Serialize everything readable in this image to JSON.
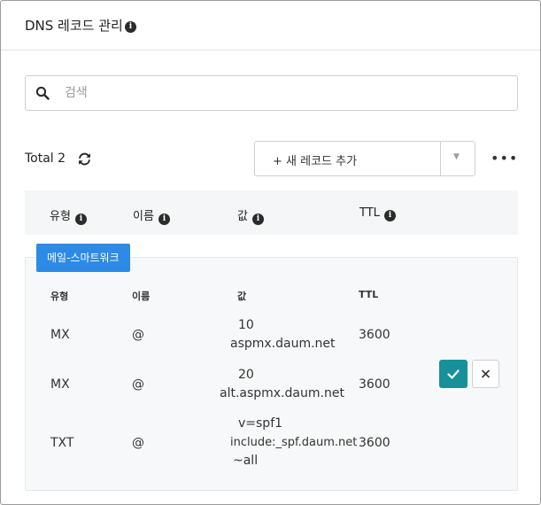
{
  "header": {
    "title": "DNS 레코드 관리"
  },
  "search": {
    "placeholder": "검색",
    "value": ""
  },
  "toolbar": {
    "total_label": "Total 2",
    "add_label": "+ 새 레코드 추가"
  },
  "table": {
    "columns": [
      "유형",
      "이름",
      "값",
      "TTL"
    ]
  },
  "group": {
    "tag": "메일-스마트워크",
    "columns": [
      "유형",
      "이름",
      "값",
      "TTL"
    ],
    "rows": [
      {
        "type": "MX",
        "name": "@",
        "value_line1": "10",
        "value_line2": "aspmx.daum.net",
        "ttl": "3600"
      },
      {
        "type": "MX",
        "name": "@",
        "value_line1": "20",
        "value_line2": "alt.aspmx.daum.net",
        "ttl": "3600"
      },
      {
        "type": "TXT",
        "name": "@",
        "value_line1": "v=spf1",
        "value_line2": "include:_spf.daum.net",
        "value_line3": "~all",
        "ttl": "3600"
      }
    ]
  },
  "colors": {
    "tag": "#2d8ae6",
    "confirm": "#17909a"
  },
  "icons": {
    "title_info": "info-icon",
    "search": "search-icon",
    "refresh": "refresh-icon",
    "more": "more-icon",
    "confirm": "check-icon",
    "cancel": "close-icon"
  }
}
